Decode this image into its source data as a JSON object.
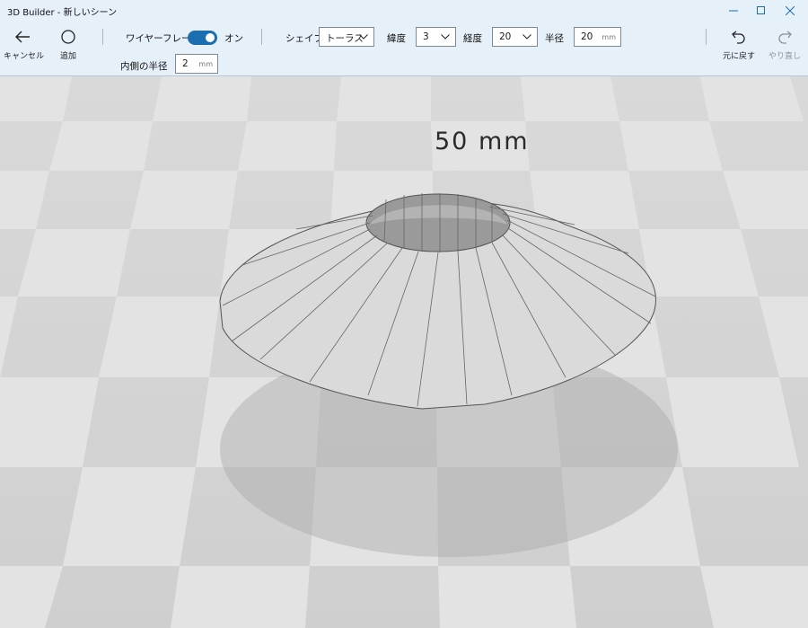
{
  "app": {
    "title": "3D Builder - 新しいシーン"
  },
  "window_controls": {
    "minimize": "minimize-icon",
    "maximize": "maximize-icon",
    "close": "close-icon"
  },
  "toolbar": {
    "cancel_label": "キャンセル",
    "add_label": "追加",
    "wireframe_label": "ワイヤーフレーム",
    "wireframe_state": "オン",
    "shape_label": "シェイプ",
    "shape_value": "トーラス",
    "latitude_label": "緯度",
    "latitude_value": "3",
    "longitude_label": "経度",
    "longitude_value": "20",
    "radius_label": "半径",
    "radius_value": "20",
    "radius_unit": "mm",
    "inner_radius_label": "内側の半径",
    "inner_radius_value": "2",
    "inner_radius_unit": "mm",
    "undo_label": "元に戻す",
    "redo_label": "やり直し"
  },
  "scene": {
    "dimension_text": "50 mm",
    "colors": {
      "accent": "#1b6fb0",
      "toolbar_bg": "#e6f0f8",
      "grid_light": "#dcdcdc",
      "grid_dark": "#cdcdcd"
    }
  }
}
